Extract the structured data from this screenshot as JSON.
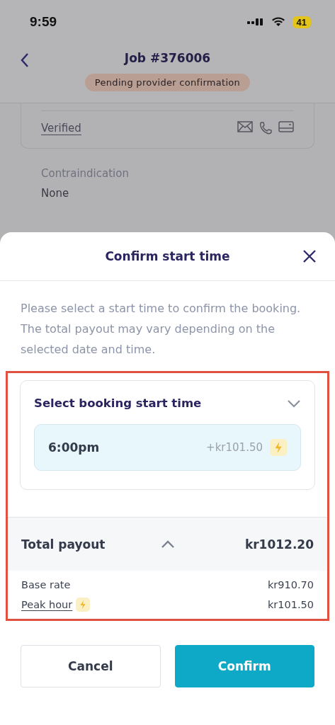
{
  "status_bar": {
    "time": "9:59",
    "battery": "41"
  },
  "header": {
    "title": "Job #376006",
    "status_badge": "Pending provider confirmation"
  },
  "background_content": {
    "verified_link": "Verified",
    "contraindication_label": "Contraindication",
    "contraindication_value": "None"
  },
  "sheet": {
    "title": "Confirm start time",
    "description": "Please select a start time to confirm the booking. The total payout may vary depending on the selected date and time.",
    "highlighted": true,
    "time_picker": {
      "label": "Select booking start time",
      "expanded": false,
      "options": [
        {
          "time": "6:00pm",
          "surcharge": "+kr101.50",
          "peak": true,
          "selected": true
        }
      ]
    },
    "payout": {
      "label": "Total payout",
      "total": "kr1012.20",
      "expanded": true,
      "items": [
        {
          "label": "Base rate",
          "amount": "kr910.70",
          "peak": false
        },
        {
          "label": "Peak hour",
          "amount": "kr101.50",
          "peak": true
        }
      ]
    },
    "buttons": [
      {
        "label": "Cancel",
        "kind": "secondary"
      },
      {
        "label": "Confirm",
        "kind": "primary"
      }
    ]
  }
}
